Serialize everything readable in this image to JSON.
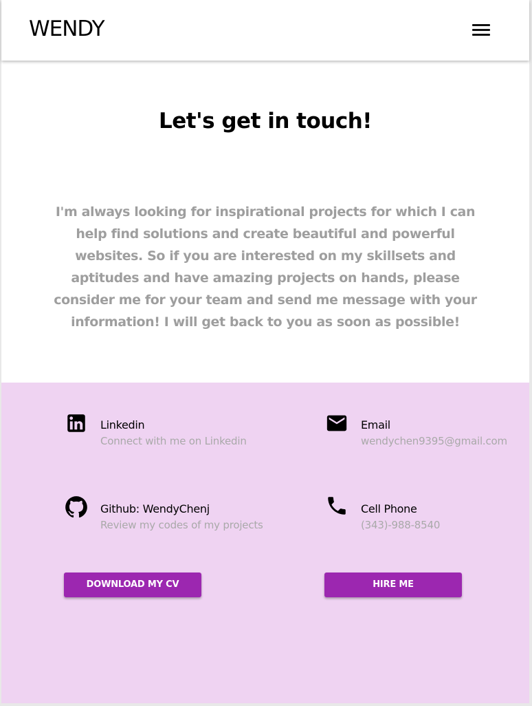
{
  "header": {
    "brand": "WENDY",
    "menu_icon": "hamburger-menu-icon"
  },
  "hero": {
    "title": "Let's get in touch!",
    "text": "I'm always looking for inspirational projects for which I can help find solutions and create beautiful and powerful websites. So if you are interested on my skillsets and aptitudes and have amazing projects on hands, please consider me for your team and send me message with your information! I will get back to you as soon as possible!"
  },
  "contact": {
    "background": "#efd3f2",
    "items": [
      {
        "icon": "linkedin-icon",
        "title": "Linkedin",
        "subtitle": "Connect with me on Linkedin"
      },
      {
        "icon": "email-icon",
        "title": "Email",
        "subtitle": "wendychen9395@gmail.com"
      },
      {
        "icon": "github-icon",
        "title": "Github: WendyChenj",
        "subtitle": "Review my codes of my projects"
      },
      {
        "icon": "phone-icon",
        "title": "Cell Phone",
        "subtitle": "(343)-988-8540"
      }
    ],
    "buttons": {
      "cv": "DOWNLOAD MY CV",
      "hire": "HIRE ME"
    },
    "accent": "#9c27b0"
  }
}
